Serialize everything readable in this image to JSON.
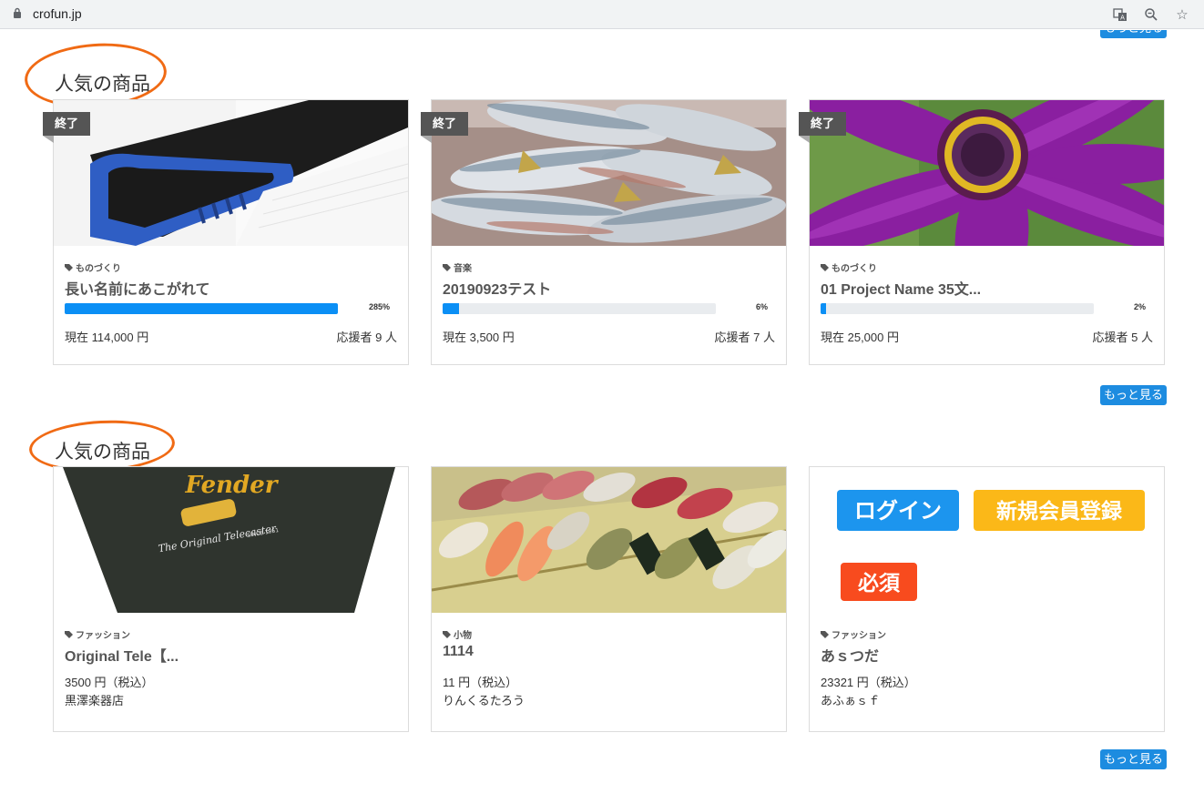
{
  "browser": {
    "url": "crofun.jp"
  },
  "sections": [
    {
      "title": "人気の商品",
      "more_label": "もっと見る",
      "cards": [
        {
          "badge": "終了",
          "category": "ものづくり",
          "title": "長い名前にあこがれて",
          "progress": 100,
          "percent_label": "285%",
          "current": "現在 114,000 円",
          "supporters": "応援者 9 人",
          "image": "brush"
        },
        {
          "badge": "終了",
          "category": "音楽",
          "title": "20190923テスト",
          "progress": 6,
          "percent_label": "6%",
          "current": "現在 3,500 円",
          "supporters": "応援者 7 人",
          "image": "fish"
        },
        {
          "badge": "終了",
          "category": "ものづくり",
          "title": "01 Project Name 35文...",
          "progress": 2,
          "percent_label": "2%",
          "current": "現在 25,000 円",
          "supporters": "応援者 5 人",
          "image": "flower"
        }
      ]
    },
    {
      "title": "人気の商品",
      "more_label": "もっと見る",
      "cards": [
        {
          "category": "ファッション",
          "title": "Original Tele【...",
          "price": "3500 円（税込）",
          "seller": "黒澤楽器店",
          "image": "tshirt",
          "image_text": {
            "line1": "Fender",
            "line2": "The Original Telecaster",
            "line3": "SINCE 1951"
          }
        },
        {
          "category": "小物",
          "title": "1114",
          "price": "11 円（税込）",
          "seller": "りんくるたろう",
          "image": "sushi"
        },
        {
          "category": "ファッション",
          "title": "あｓつだ",
          "price": "23321 円（税込）",
          "seller": "あふぁｓｆ",
          "image": "buttons",
          "image_text": {
            "login": "ログイン",
            "register": "新規会員登録",
            "required": "必須"
          }
        }
      ]
    }
  ],
  "top_more_label": "もっと見る",
  "colors": {
    "accent": "#1d8ce0",
    "progress": "#0b8ff5",
    "annotation": "#f06a14",
    "badge": "#555555"
  }
}
